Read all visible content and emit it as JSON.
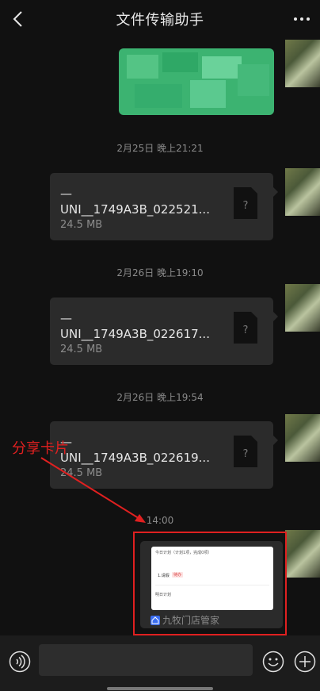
{
  "header": {
    "title": "文件传输助手"
  },
  "messages": [
    {
      "timestamp": "2月25日 晚上21:21",
      "file_name": "—\nUNI__1749A3B_022521...",
      "file_size": "24.5 MB"
    },
    {
      "timestamp": "2月26日 晚上19:10",
      "file_name": "—\nUNI__1749A3B_022617...",
      "file_size": "24.5 MB"
    },
    {
      "timestamp": "2月26日 晚上19:54",
      "file_name": "—\nUNI__1749A3B_022619...",
      "file_size": "24.5 MB"
    }
  ],
  "card_message": {
    "timestamp": "14:00",
    "preview": {
      "today_plan": "今日计划（计划1项，完成0项）",
      "item": "1.请假",
      "item_tag": "待办",
      "tomorrow_plan": "明日计划"
    },
    "app_name": "九牧门店管家"
  },
  "annotation": {
    "label": "分享卡片"
  },
  "input_bar": {
    "value": ""
  },
  "colors": {
    "background": "#111111",
    "bubble": "#2b2b2b",
    "annotation_red": "#e02020",
    "outgoing_green": "#3cb371"
  },
  "icons": {
    "back": "chevron-left-icon",
    "more": "more-dots-icon",
    "file": "unknown-file-icon",
    "voice": "voice-icon",
    "emoji": "emoji-icon",
    "plus": "plus-icon"
  }
}
